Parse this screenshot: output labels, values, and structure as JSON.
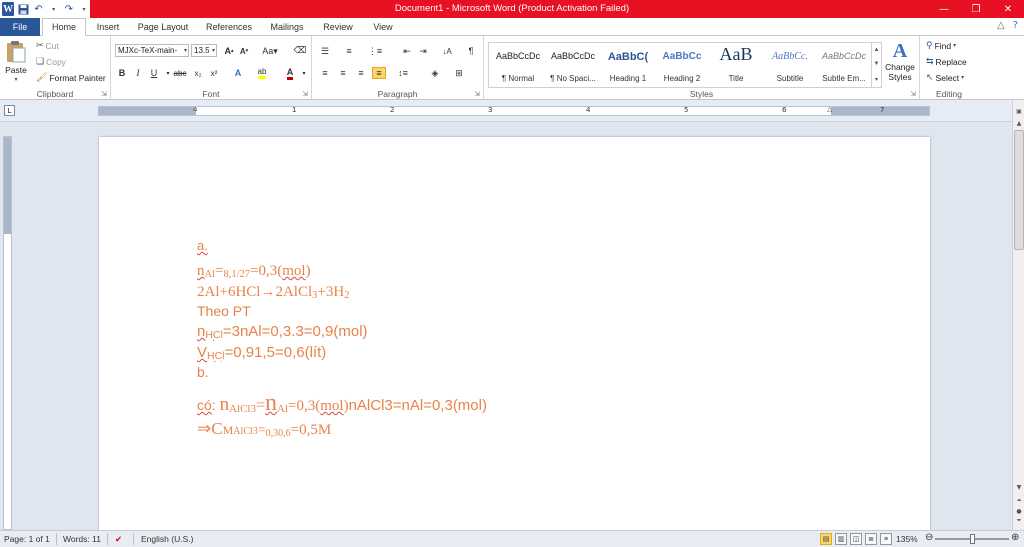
{
  "window": {
    "title": "Document1  -  Microsoft Word (Product Activation Failed)",
    "brand_color": "#e81123"
  },
  "tabs": [
    {
      "label": "File"
    },
    {
      "label": "Home"
    },
    {
      "label": "Insert"
    },
    {
      "label": "Page Layout"
    },
    {
      "label": "References"
    },
    {
      "label": "Mailings"
    },
    {
      "label": "Review"
    },
    {
      "label": "View"
    }
  ],
  "ribbon": {
    "clipboard": {
      "label": "Clipboard",
      "paste": "Paste",
      "cut": "Cut",
      "copy": "Copy",
      "format_painter": "Format Painter"
    },
    "font": {
      "label": "Font",
      "family": "MJXc-TeX-main-",
      "size": "13.5",
      "font_color": "#c00000"
    },
    "paragraph": {
      "label": "Paragraph"
    },
    "styles": {
      "label": "Styles",
      "items": [
        {
          "preview": "AaBbCcDc",
          "name": "¶ Normal"
        },
        {
          "preview": "AaBbCcDc",
          "name": "¶ No Spaci..."
        },
        {
          "preview": "AaBbC(",
          "name": "Heading 1"
        },
        {
          "preview": "AaBbCc",
          "name": "Heading 2"
        },
        {
          "preview": "AaB",
          "name": "Title"
        },
        {
          "preview": "AaBbCc.",
          "name": "Subtitle"
        },
        {
          "preview": "AaBbCcDc",
          "name": "Subtle Em..."
        }
      ],
      "change_styles": "Change Styles"
    },
    "editing": {
      "label": "Editing",
      "find": "Find",
      "replace": "Replace",
      "select": "Select"
    }
  },
  "ruler": {
    "numbers": [
      "1",
      "2",
      "3",
      "4",
      "5",
      "6",
      "7"
    ]
  },
  "document": {
    "text_color": "#e8834a",
    "line_a": "a.",
    "line_nal_1": "n",
    "line_nal_1_sub": "Al",
    "line_nal_2": "=",
    "line_nal_frac": "8,1/27",
    "line_nal_3": "=0,3(",
    "line_nal_mol": "mol",
    "line_nal_4": ")",
    "eq_1": " 2Al+6HCl→2AlCl",
    "eq_sub1": "3",
    "eq_2": "+3H",
    "eq_sub2": "2",
    "theo": "Theo PT",
    "nhcl_n": "n",
    "nhcl_sub": "HCl",
    "nhcl_rest": "=3nAl=0,3.3=0,9(mol)",
    "vhcl_v": "V",
    "vhcl_sub": "HCl",
    "vhcl_rest": "=0,91,5=0,6(lít)",
    "line_b": "b.",
    "co": "có",
    "co_colon": ": ",
    "co_n1": "n",
    "co_sub1": "AlCl3",
    "co_eq1": "=",
    "co_n2": "n",
    "co_sub2": "Al",
    "co_eq2": "=0,3(",
    "co_mol": "mol",
    "co_close": ")",
    "co_tail": "nAlCl3=nAl=0,3(mol)",
    "cm_arrow": "⇒C",
    "cm_sub1": "M",
    "cm_sub2": "AlCl3",
    "cm_eq": "=",
    "cm_frac": "0,30,6",
    "cm_rest": "=0,5M"
  },
  "status": {
    "page": "Page: 1 of 1",
    "words": "Words: 11",
    "language": "English (U.S.)",
    "zoom": "135%"
  }
}
